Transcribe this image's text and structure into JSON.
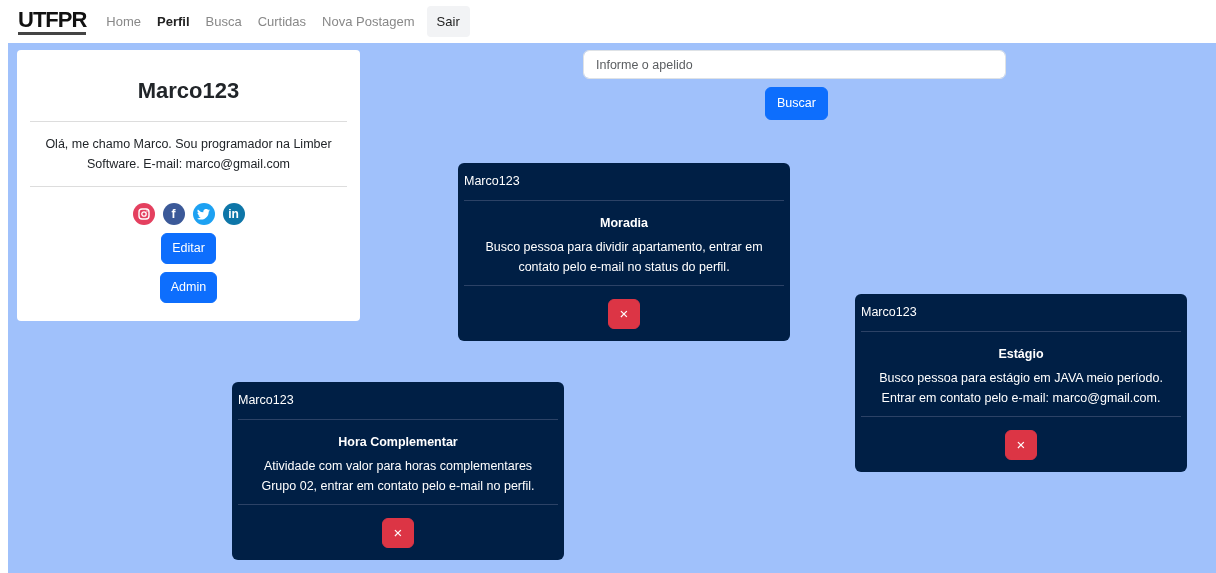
{
  "navbar": {
    "logo": "UTFPR",
    "links": [
      {
        "label": "Home",
        "selected": false
      },
      {
        "label": "Perfil",
        "selected": true
      },
      {
        "label": "Busca",
        "selected": false
      },
      {
        "label": "Curtidas",
        "selected": false
      },
      {
        "label": "Nova Postagem",
        "selected": false
      }
    ],
    "logout": "Sair"
  },
  "profile": {
    "name": "Marco123",
    "bio": "Olá, me chamo Marco. Sou programador na Limber Software. E-mail: marco@gmail.com",
    "social": [
      {
        "kind": "instagram",
        "color": "#e4405f"
      },
      {
        "kind": "facebook",
        "color": "#3b5998",
        "glyph": "f"
      },
      {
        "kind": "twitter",
        "color": "#1da1f2"
      },
      {
        "kind": "linkedin",
        "color": "#0e76a8",
        "glyph": "in"
      }
    ],
    "buttons": [
      "Editar",
      "Admin"
    ]
  },
  "search": {
    "placeholder": "Informe o apelido",
    "button": "Buscar"
  },
  "posts": [
    {
      "author": "Marco123",
      "title": "Moradia",
      "body": "Busco pessoa para dividir apartamento, entrar em contato pelo e-mail no status do perfil.",
      "delete": "×"
    },
    {
      "author": "Marco123",
      "title": "Estágio",
      "body": "Busco pessoa para estágio em JAVA meio período. Entrar em contato pelo e-mail: marco@gmail.com.",
      "delete": "×"
    },
    {
      "author": "Marco123",
      "title": "Hora Complementar",
      "body": "Atividade com valor para horas complementares Grupo 02, entrar em contato pelo e-mail no perfil.",
      "delete": "×"
    }
  ]
}
